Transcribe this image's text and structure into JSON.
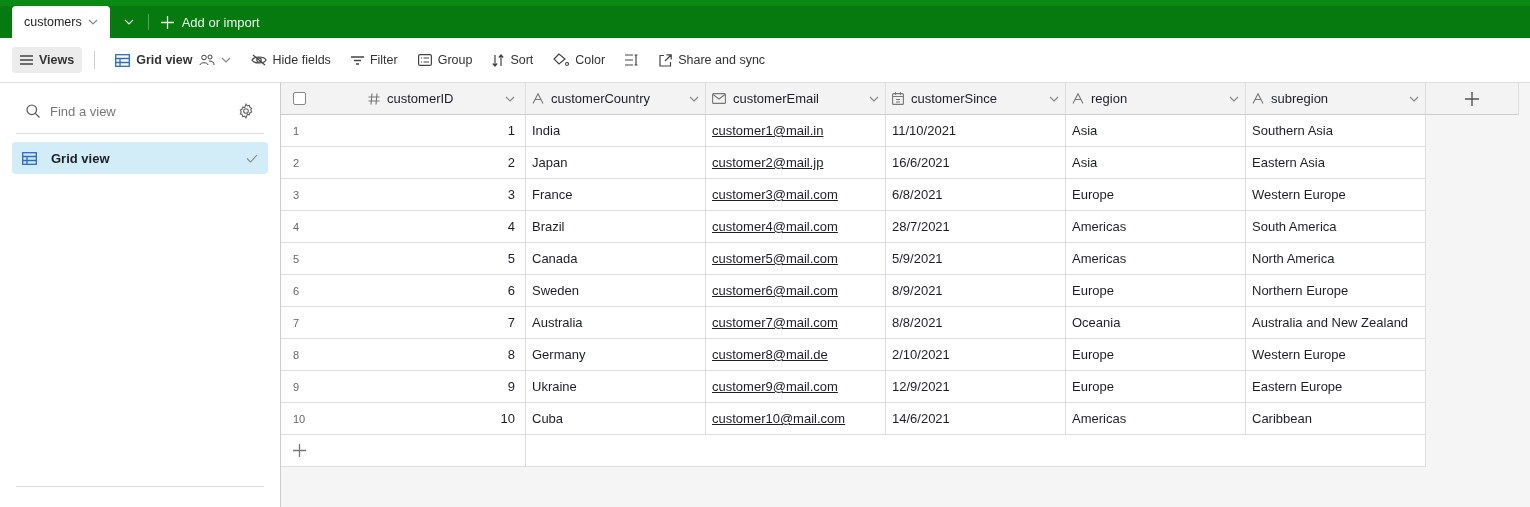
{
  "tabs": [
    {
      "label": "customers",
      "selected": true
    }
  ],
  "add_import": "Add or import",
  "toolbar": [
    {
      "kind": "views",
      "label": "Views",
      "selected": true
    },
    {
      "kind": "grid",
      "label": "Grid view",
      "selected": false
    },
    {
      "kind": "hide",
      "label": "Hide fields",
      "selected": false
    },
    {
      "kind": "filter",
      "label": "Filter",
      "selected": false
    },
    {
      "kind": "group",
      "label": "Group",
      "selected": false
    },
    {
      "kind": "sort",
      "label": "Sort",
      "selected": false
    },
    {
      "kind": "color",
      "label": "Color",
      "selected": false
    },
    {
      "kind": "height",
      "selected": false
    },
    {
      "kind": "share",
      "label": "Share and sync",
      "selected": false
    }
  ],
  "sidebar": {
    "search": {
      "placeholder": "Find a view"
    },
    "views": [
      {
        "label": "Grid view",
        "selected": true
      }
    ]
  },
  "table": {
    "select_all": {
      "checked": false
    },
    "columns": [
      {
        "name": "customerID",
        "kind": "number"
      },
      {
        "name": "customerCountry",
        "kind": "text"
      },
      {
        "name": "customerEmail",
        "kind": "email"
      },
      {
        "name": "customerSince",
        "kind": "date"
      },
      {
        "name": "region",
        "kind": "text"
      },
      {
        "name": "subregion",
        "kind": "text"
      }
    ],
    "rows": [
      {
        "number": "1",
        "cells": [
          "1",
          "India",
          "customer1@mail.in",
          "11/10/2021",
          "Asia",
          "Southern Asia"
        ]
      },
      {
        "number": "2",
        "cells": [
          "2",
          "Japan",
          "customer2@mail.jp",
          "16/6/2021",
          "Asia",
          "Eastern Asia"
        ]
      },
      {
        "number": "3",
        "cells": [
          "3",
          "France",
          "customer3@mail.com",
          "6/8/2021",
          "Europe",
          "Western Europe"
        ]
      },
      {
        "number": "4",
        "cells": [
          "4",
          "Brazil",
          "customer4@mail.com",
          "28/7/2021",
          "Americas",
          "South America"
        ]
      },
      {
        "number": "5",
        "cells": [
          "5",
          "Canada",
          "customer5@mail.com",
          "5/9/2021",
          "Americas",
          "North America"
        ]
      },
      {
        "number": "6",
        "cells": [
          "6",
          "Sweden",
          "customer6@mail.com",
          "8/9/2021",
          "Europe",
          "Northern Europe"
        ]
      },
      {
        "number": "7",
        "cells": [
          "7",
          "Australia",
          "customer7@mail.com",
          "8/8/2021",
          "Oceania",
          "Australia and New Zealand"
        ]
      },
      {
        "number": "8",
        "cells": [
          "8",
          "Germany",
          "customer8@mail.de",
          "2/10/2021",
          "Europe",
          "Western Europe"
        ]
      },
      {
        "number": "9",
        "cells": [
          "9",
          "Ukraine",
          "customer9@mail.com",
          "12/9/2021",
          "Europe",
          "Eastern Europe"
        ]
      },
      {
        "number": "10",
        "cells": [
          "10",
          "Cuba",
          "customer10@mail.com",
          "14/6/2021",
          "Americas",
          "Caribbean"
        ]
      }
    ]
  }
}
